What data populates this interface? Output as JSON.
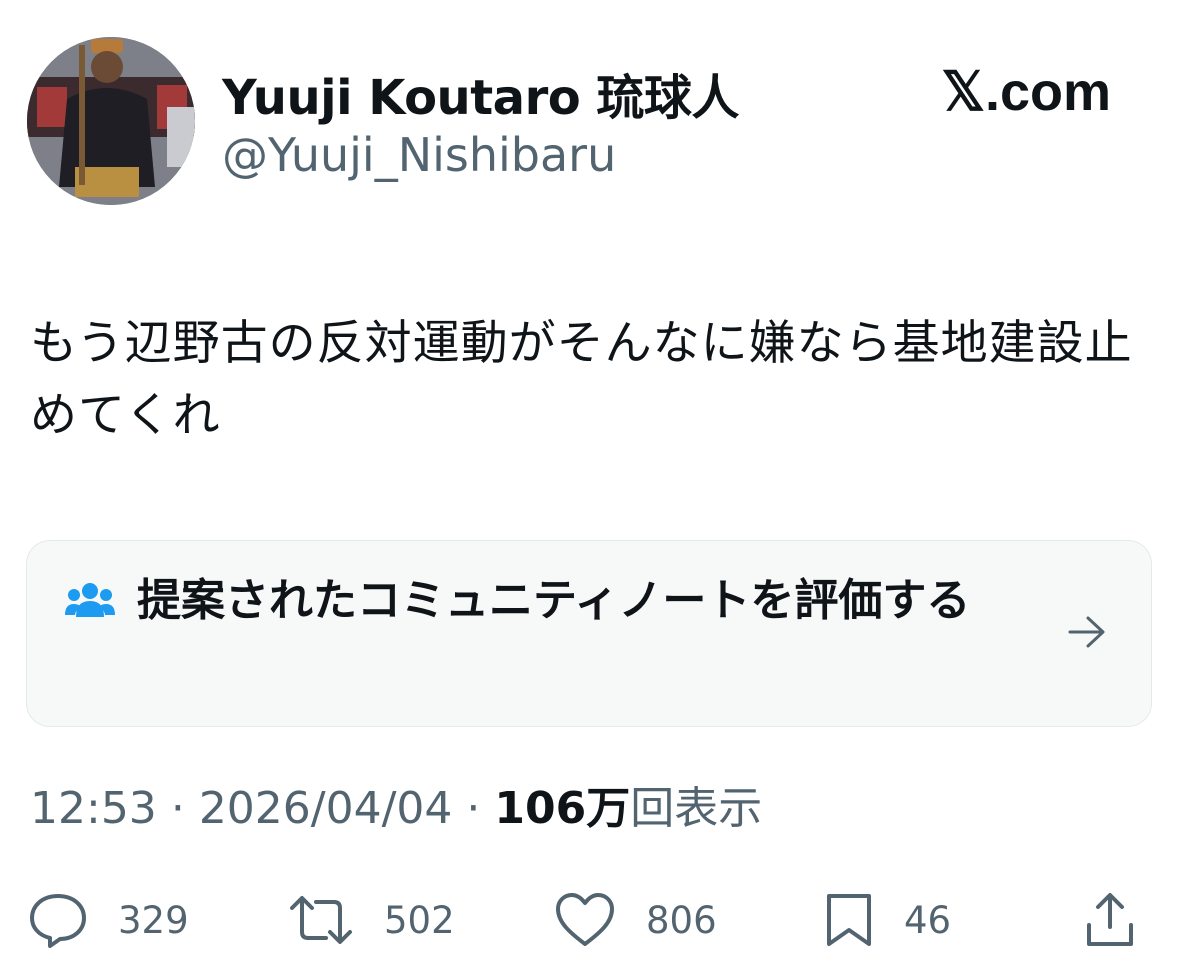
{
  "author": {
    "display_name": "Yuuji Koutaro 琉球人",
    "handle": "@Yuuji_Nishibaru",
    "avatar": "profile-photo"
  },
  "site": {
    "logo_text": "𝕏.com"
  },
  "tweet": {
    "text": "もう辺野古の反対運動がそんなに嫌なら基地建設止めてくれ"
  },
  "community_note": {
    "icon": "people-icon",
    "label": "提案されたコミュニティノートを評価する",
    "arrow_icon": "arrow-right-icon"
  },
  "meta": {
    "time": "12:53",
    "separator": "·",
    "date": "2026/04/04",
    "views_count": "106万",
    "views_label": "回表示"
  },
  "actions": {
    "replies": {
      "icon": "reply-icon",
      "count": "329"
    },
    "reposts": {
      "icon": "repost-icon",
      "count": "502"
    },
    "likes": {
      "icon": "heart-icon",
      "count": "806"
    },
    "bookmarks": {
      "icon": "bookmark-icon",
      "count": "46"
    },
    "share": {
      "icon": "share-icon"
    }
  },
  "colors": {
    "text_primary": "#0f1419",
    "text_secondary": "#536471",
    "note_icon": "#1d9bf0",
    "card_bg": "#f7f9f9"
  }
}
